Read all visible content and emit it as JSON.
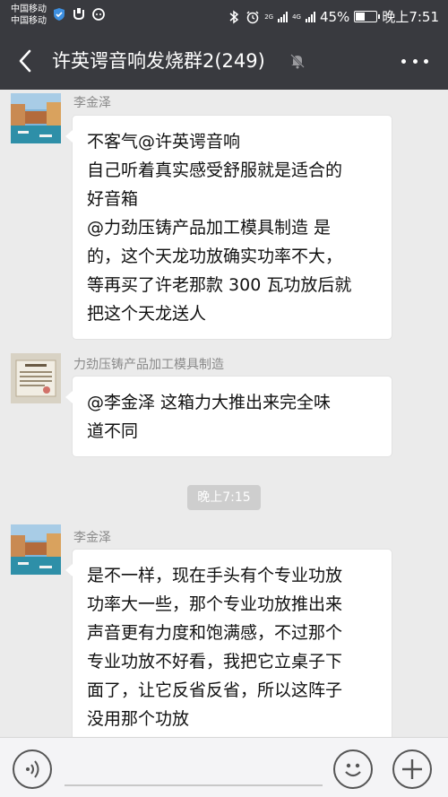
{
  "status_bar": {
    "carrier_1": "中国移动",
    "carrier_2": "中国移动",
    "net_2g": "2G",
    "net_4g": "4G",
    "battery_percent": "45%",
    "battery_level": 0.45,
    "time": "晚上7:51"
  },
  "nav": {
    "title": "许英谔音响发烧群2(249)"
  },
  "messages": [
    {
      "sender": "李金泽",
      "lines": [
        "不客气@许英谔音响",
        "自己听着真实感受舒服就是适合的",
        "好音箱",
        "@力劲压铸产品加工模具制造  是",
        "的，这个天龙功放确实功率不大，",
        "等再买了许老那款 300 瓦功放后就",
        "把这个天龙送人"
      ]
    },
    {
      "sender": "力劲压铸产品加工模具制造",
      "lines": [
        "@李金泽  这箱力大推出来完全味",
        "道不同"
      ]
    },
    {
      "sender": "李金泽",
      "lines": [
        "是不一样，现在手头有个专业功放",
        "功率大一些，那个专业功放推出来",
        "声音更有力度和饱满感，不过那个",
        "专业功放不好看，我把它立桌子下",
        "面了，让它反省反省，所以这阵子",
        "没用那个功放"
      ]
    }
  ],
  "time_divider": "晚上7:15",
  "icons": [
    "back-arrow-icon",
    "mute-bell-icon",
    "more-dots-icon",
    "voice-icon",
    "emoji-icon",
    "plus-icon"
  ],
  "colors": {
    "header_bg": "#393a3f",
    "chat_bg": "#ebebeb",
    "bubble_bg": "#ffffff"
  }
}
